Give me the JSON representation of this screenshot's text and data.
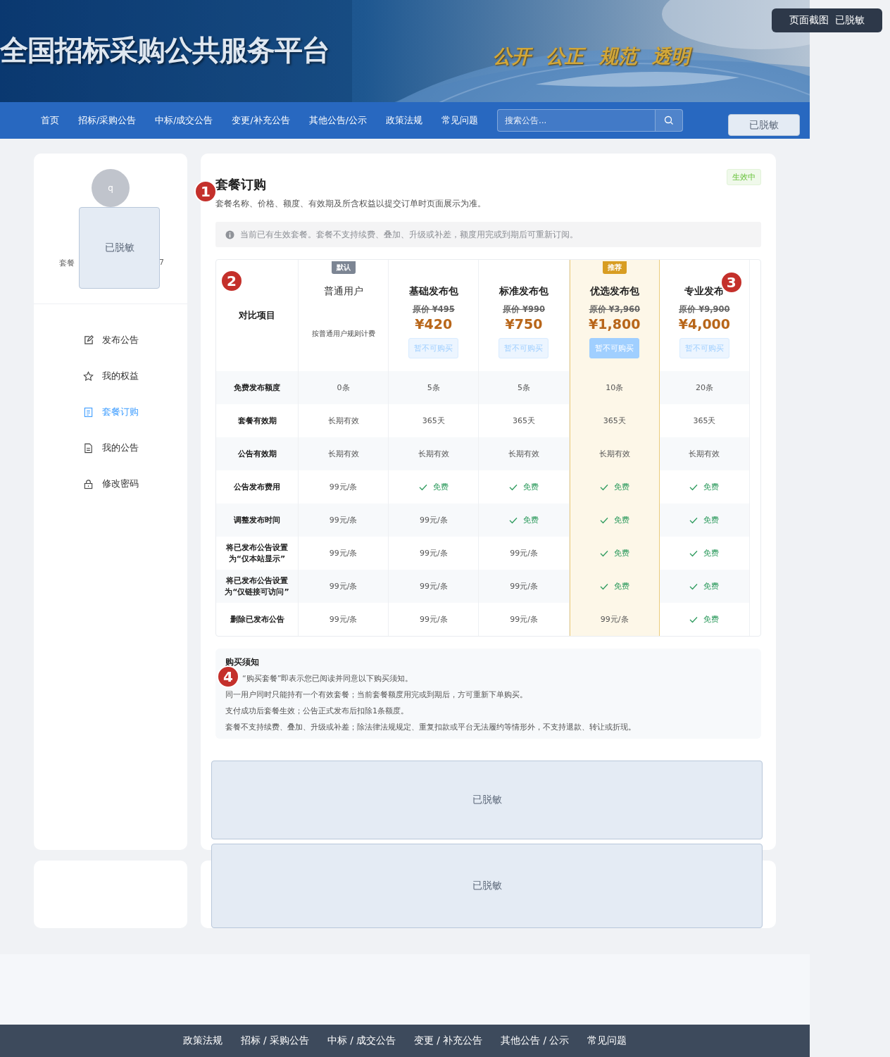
{
  "screenshot_badge": "页面截图  已脱敏",
  "header": {
    "title": "全国招标采购公共服务平台",
    "slogan": "公开 公正 规范 透明"
  },
  "nav": {
    "items": [
      "首页",
      "招标/采购公告",
      "中标/成交公告",
      "变更/补充公告",
      "其他公告/公示",
      "政策法规",
      "常见问题"
    ],
    "search": {
      "placeholder": "搜索公告..."
    },
    "redacted": "已脱敏"
  },
  "sidebar": {
    "avatar": "q",
    "redacted": "已脱敏",
    "plan_line": "套餐",
    "plan_line_end": "7",
    "menu": [
      {
        "label": "发布公告",
        "selected": false
      },
      {
        "label": "我的权益",
        "selected": false
      },
      {
        "label": "套餐订购",
        "selected": true
      },
      {
        "label": "我的公告",
        "selected": false
      },
      {
        "label": "修改密码",
        "selected": false
      }
    ]
  },
  "page": {
    "title": "套餐订购",
    "subtitle": "套餐名称、价格、额度、有效期及所含权益以提交订单时页面展示为准。",
    "status": "生效中",
    "notice": "当前已有生效套餐。套餐不支持续费、叠加、升级或补差，额度用完或到期后可重新订阅。"
  },
  "comparison": {
    "header": "对比项目",
    "plans": [
      {
        "badge": "默认",
        "name": "普通用户",
        "note": "按普通用户规则计费",
        "recommended": false
      },
      {
        "name": "基础发布包",
        "original_price": "原价 ¥495",
        "price": "¥420",
        "button": "暂不可购买",
        "recommended": false
      },
      {
        "name": "标准发布包",
        "original_price": "原价 ¥990",
        "price": "¥750",
        "button": "暂不可购买",
        "recommended": false
      },
      {
        "badge": "推荐",
        "name": "优选发布包",
        "original_price": "原价 ¥3,960",
        "price": "¥1,800",
        "button": "暂不可购买",
        "recommended": true
      },
      {
        "name": "专业发布",
        "original_price": "原价 ¥9,900",
        "price": "¥4,000",
        "button": "暂不可购买",
        "recommended": false
      }
    ],
    "rows": [
      {
        "label": "免费发布额度",
        "cells": [
          {
            "kind": "text",
            "text": "0条"
          },
          {
            "kind": "text",
            "text": "5条"
          },
          {
            "kind": "text",
            "text": "5条"
          },
          {
            "kind": "text",
            "text": "10条"
          },
          {
            "kind": "text",
            "text": "20条"
          }
        ]
      },
      {
        "label": "套餐有效期",
        "cells": [
          {
            "kind": "text",
            "text": "长期有效"
          },
          {
            "kind": "text",
            "text": "365天"
          },
          {
            "kind": "text",
            "text": "365天"
          },
          {
            "kind": "text",
            "text": "365天"
          },
          {
            "kind": "text",
            "text": "365天"
          }
        ]
      },
      {
        "label": "公告有效期",
        "cells": [
          {
            "kind": "text",
            "text": "长期有效"
          },
          {
            "kind": "text",
            "text": "长期有效"
          },
          {
            "kind": "text",
            "text": "长期有效"
          },
          {
            "kind": "text",
            "text": "长期有效"
          },
          {
            "kind": "text",
            "text": "长期有效"
          }
        ]
      },
      {
        "label": "公告发布费用",
        "cells": [
          {
            "kind": "text",
            "text": "99元/条"
          },
          {
            "kind": "free",
            "text": "免费"
          },
          {
            "kind": "free",
            "text": "免费"
          },
          {
            "kind": "free",
            "text": "免费"
          },
          {
            "kind": "free",
            "text": "免费"
          }
        ]
      },
      {
        "label": "调整发布时间",
        "cells": [
          {
            "kind": "text",
            "text": "99元/条"
          },
          {
            "kind": "text",
            "text": "99元/条"
          },
          {
            "kind": "free",
            "text": "免费"
          },
          {
            "kind": "free",
            "text": "免费"
          },
          {
            "kind": "free",
            "text": "免费"
          }
        ]
      },
      {
        "label": "将已发布公告设置为“仅本站显示”",
        "cells": [
          {
            "kind": "text",
            "text": "99元/条"
          },
          {
            "kind": "text",
            "text": "99元/条"
          },
          {
            "kind": "text",
            "text": "99元/条"
          },
          {
            "kind": "free",
            "text": "免费"
          },
          {
            "kind": "free",
            "text": "免费"
          }
        ]
      },
      {
        "label": "将已发布公告设置为“仅链接可访问”",
        "cells": [
          {
            "kind": "text",
            "text": "99元/条"
          },
          {
            "kind": "text",
            "text": "99元/条"
          },
          {
            "kind": "text",
            "text": "99元/条"
          },
          {
            "kind": "free",
            "text": "免费"
          },
          {
            "kind": "free",
            "text": "免费"
          }
        ]
      },
      {
        "label": "删除已发布公告",
        "cells": [
          {
            "kind": "text",
            "text": "99元/条"
          },
          {
            "kind": "text",
            "text": "99元/条"
          },
          {
            "kind": "text",
            "text": "99元/条"
          },
          {
            "kind": "text",
            "text": "99元/条"
          },
          {
            "kind": "free",
            "text": "免费"
          }
        ]
      }
    ]
  },
  "purchase_notice": {
    "title": "购买须知",
    "lines": [
      "“购买套餐”即表示您已阅读并同意以下购买须知。",
      "同一用户同时只能持有一个有效套餐；当前套餐额度用完或到期后，方可重新下单购买。",
      "支付成功后套餐生效；公告正式发布后扣除1条额度。",
      "套餐不支持续费、叠加、升级或补差；除法律法规规定、重复扣款或平台无法履约等情形外，不支持退款、转让或折现。"
    ]
  },
  "records_redacted": [
    "已脱敏",
    "已脱敏"
  ],
  "markers": [
    "1",
    "2",
    "3",
    "4"
  ],
  "footer": {
    "links": [
      "政策法规",
      "招标 / 采购公告",
      "中标 / 成交公告",
      "变更 / 补充公告",
      "其他公告 / 公示",
      "常见问题"
    ]
  }
}
